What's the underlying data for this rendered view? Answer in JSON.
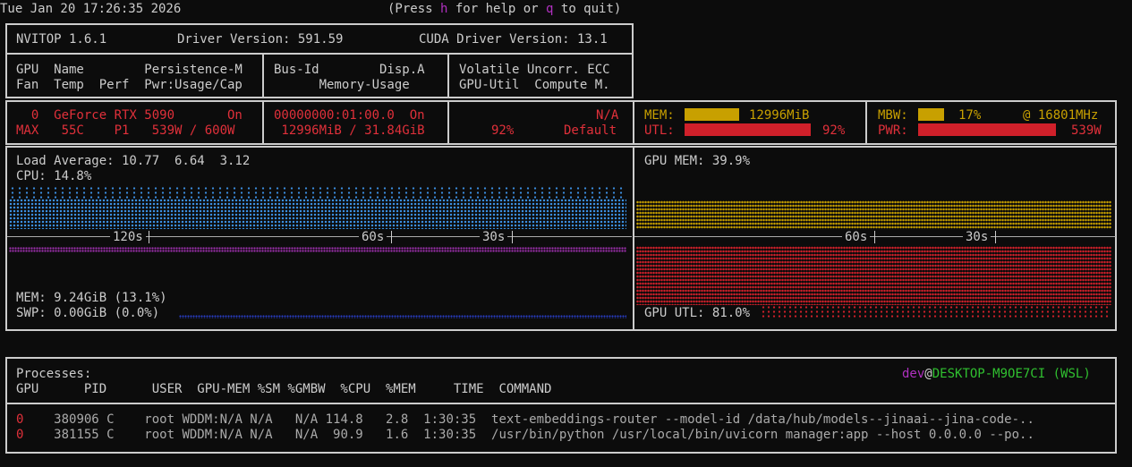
{
  "topbar": {
    "datetime": "Tue Jan 20 17:26:35 2026",
    "help_prefix": "(Press ",
    "help_key": "h",
    "help_mid": " for help or ",
    "quit_key": "q",
    "help_suffix": " to quit)"
  },
  "header": {
    "version": "NVITOP 1.6.1",
    "driver": "Driver Version: 591.59",
    "cuda": "CUDA Driver Version: 13.1"
  },
  "columns": {
    "c1_line1": "GPU  Name        Persistence-M",
    "c1_line2": "Fan  Temp  Perf  Pwr:Usage/Cap",
    "c2_line1": "Bus-Id        Disp.A",
    "c2_line2": "      Memory-Usage",
    "c3_line1": "Volatile Uncorr. ECC",
    "c3_line2": "GPU-Util  Compute M."
  },
  "gpu": {
    "row1_left": "  0  GeForce RTX 5090       On",
    "row2_left": "MAX   55C    P1   539W / 600W",
    "row1_bus": "00000000:01:00.0  On",
    "row2_mem": " 12996MiB / 31.84GiB",
    "row1_ecc": "N/A",
    "row2_util": "92%",
    "row2_compute": "Default",
    "mem_label": "MEM:",
    "mem_value": "12996MiB",
    "mem_frac": 0.46,
    "utl_label": "UTL:",
    "utl_value": "92%",
    "utl_frac": 0.92,
    "mbw_label": "MBW:",
    "mbw_value": "17%",
    "mbw_clock": "@ 16801MHz",
    "mbw_frac": 0.17,
    "pwr_label": "PWR:",
    "pwr_value": "539W",
    "pwr_frac": 0.9
  },
  "host_panel": {
    "load_average": "Load Average: 10.77  6.64  3.12",
    "cpu": "CPU: 14.8%",
    "time_axis_left": [
      "120s",
      "60s",
      "30s"
    ],
    "mem": "MEM: 9.24GiB (13.1%)",
    "swp": "SWP: 0.00GiB (0.0%)"
  },
  "gpu_panel": {
    "gpu_mem": "GPU MEM: 39.9%",
    "time_axis_right": [
      "60s",
      "30s"
    ],
    "gpu_utl": "GPU UTL: 81.0%"
  },
  "processes": {
    "title": "Processes:",
    "user": "dev",
    "at": "@",
    "host": "DESKTOP-M9OE7CI",
    "platform": " (WSL)",
    "header": "GPU      PID      USER  GPU-MEM %SM %GMBW  %CPU  %MEM     TIME  COMMAND",
    "rows": [
      {
        "gpu": "0",
        "rest": "380906 C    root WDDM:N/A N/A   N/A 114.8   2.8  1:30:35  text-embeddings-router --model-id /data/hub/models--jinaai--jina-code-.."
      },
      {
        "gpu": "0",
        "rest": "381155 C    root WDDM:N/A N/A   N/A  90.9   1.6  1:30:35  /usr/bin/python /usr/local/bin/uvicorn manager:app --host 0.0.0.0 --po.."
      }
    ]
  },
  "colors": {
    "background": "#0c0c0c",
    "text": "#cccccc",
    "red": "#e0303a",
    "gold": "#c8a000",
    "magenta": "#b030c0",
    "green": "#30c030",
    "cpu_blue": "#3b8ee0"
  }
}
